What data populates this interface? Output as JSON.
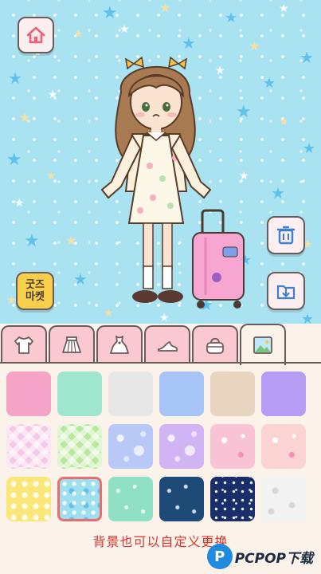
{
  "scene": {
    "background_color": "#a9e3f2",
    "home_icon": "home-icon",
    "trash_icon": "trash-icon",
    "save_icon": "download-folder-icon",
    "market_label": "굿즈\n마켓"
  },
  "tabs": [
    {
      "name": "tab-tops",
      "icon": "tshirt-icon",
      "active": false
    },
    {
      "name": "tab-skirts",
      "icon": "skirt-icon",
      "active": false
    },
    {
      "name": "tab-dresses",
      "icon": "dress-icon",
      "active": false
    },
    {
      "name": "tab-shoes",
      "icon": "shoe-icon",
      "active": false
    },
    {
      "name": "tab-bags",
      "icon": "bag-icon",
      "active": false
    },
    {
      "name": "tab-backgrounds",
      "icon": "picture-icon",
      "active": true
    }
  ],
  "swatches": [
    {
      "style": "solid",
      "color": "#f6a3c8"
    },
    {
      "style": "solid",
      "color": "#9fe6cf"
    },
    {
      "style": "solid",
      "color": "#e7e7e7"
    },
    {
      "style": "solid",
      "color": "#a7c4f7"
    },
    {
      "style": "solid",
      "color": "#e8d6c0"
    },
    {
      "style": "solid",
      "color": "#b49df3"
    },
    {
      "style": "plaid",
      "color": "#f5c8e6"
    },
    {
      "style": "plaid",
      "color": "#b9e89d"
    },
    {
      "style": "bokeh",
      "color": "#b8c9f7"
    },
    {
      "style": "bokeh",
      "color": "#d1b4f4"
    },
    {
      "style": "hearts",
      "color": "#f9c3d6"
    },
    {
      "style": "hearts",
      "color": "#fbd3d3"
    },
    {
      "style": "dots",
      "color": "#fbe67a"
    },
    {
      "style": "stars",
      "color": "#9fe0ef",
      "selected": true
    },
    {
      "style": "confetti",
      "color": "#8fe0c4"
    },
    {
      "style": "confetti",
      "color": "#1e4a78"
    },
    {
      "style": "sparkle",
      "color": "#1a2f69"
    },
    {
      "style": "leaves",
      "color": "#f3f3f3"
    }
  ],
  "caption": "背景也可以自定义更换",
  "watermark": {
    "mark": "P",
    "text": "PCPOP下载"
  }
}
